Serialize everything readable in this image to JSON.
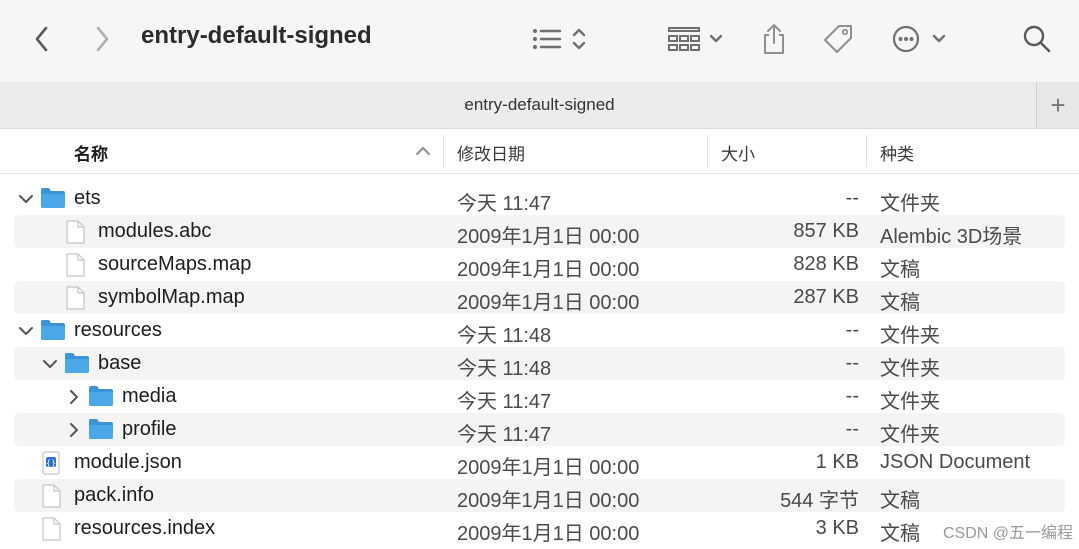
{
  "window": {
    "title": "entry-default-signed"
  },
  "toolbar": {
    "back_icon": "chevron-left-icon",
    "forward_icon": "chevron-right-icon",
    "view_icon": "list-view-icon",
    "group_icon": "grid-group-icon",
    "share_icon": "share-icon",
    "tag_icon": "tag-icon",
    "more_icon": "ellipsis-circle-icon",
    "search_icon": "search-icon"
  },
  "tab": {
    "label": "entry-default-signed",
    "add_label": "+"
  },
  "columns": {
    "name": "名称",
    "date": "修改日期",
    "size": "大小",
    "kind": "种类"
  },
  "rows": [
    {
      "name": "ets",
      "date": "今天 11:47",
      "size": "--",
      "kind": "文件夹",
      "type": "folder",
      "depth": 0,
      "disclosure": "open"
    },
    {
      "name": "modules.abc",
      "date": "2009年1月1日 00:00",
      "size": "857 KB",
      "kind": "Alembic 3D场景",
      "type": "file",
      "depth": 1,
      "disclosure": "none"
    },
    {
      "name": "sourceMaps.map",
      "date": "2009年1月1日 00:00",
      "size": "828 KB",
      "kind": "文稿",
      "type": "file",
      "depth": 1,
      "disclosure": "none"
    },
    {
      "name": "symbolMap.map",
      "date": "2009年1月1日 00:00",
      "size": "287 KB",
      "kind": "文稿",
      "type": "file",
      "depth": 1,
      "disclosure": "none"
    },
    {
      "name": "resources",
      "date": "今天 11:48",
      "size": "--",
      "kind": "文件夹",
      "type": "folder",
      "depth": 0,
      "disclosure": "open"
    },
    {
      "name": "base",
      "date": "今天 11:48",
      "size": "--",
      "kind": "文件夹",
      "type": "folder",
      "depth": 1,
      "disclosure": "open"
    },
    {
      "name": "media",
      "date": "今天 11:47",
      "size": "--",
      "kind": "文件夹",
      "type": "folder",
      "depth": 2,
      "disclosure": "closed"
    },
    {
      "name": "profile",
      "date": "今天 11:47",
      "size": "--",
      "kind": "文件夹",
      "type": "folder",
      "depth": 2,
      "disclosure": "closed"
    },
    {
      "name": "module.json",
      "date": "2009年1月1日 00:00",
      "size": "1 KB",
      "kind": "JSON Document",
      "type": "json",
      "depth": 0,
      "disclosure": "none"
    },
    {
      "name": "pack.info",
      "date": "2009年1月1日 00:00",
      "size": "544 字节",
      "kind": "文稿",
      "type": "file",
      "depth": 0,
      "disclosure": "none"
    },
    {
      "name": "resources.index",
      "date": "2009年1月1日 00:00",
      "size": "3 KB",
      "kind": "文稿",
      "type": "file",
      "depth": 0,
      "disclosure": "none"
    }
  ],
  "watermark": "CSDN @五一编程",
  "colors": {
    "folder": "#4aa7e8",
    "folder_tab": "#3b94d6",
    "row_alt": "#f4f4f5"
  }
}
